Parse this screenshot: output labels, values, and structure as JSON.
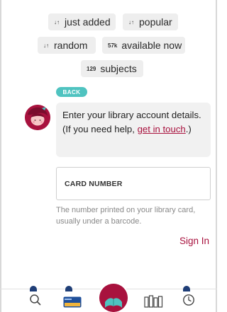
{
  "colors": {
    "brand": "#a8123e",
    "accent_teal": "#4fc3c0",
    "nav_dot": "#1f3e77",
    "chip_bg": "#eeeeee",
    "bubble_bg": "#f1f1f1"
  },
  "chips": {
    "just_added": {
      "icon": "sort-icon",
      "glyph": "↓↑",
      "label": "just added"
    },
    "popular": {
      "icon": "sort-icon",
      "glyph": "↓↑",
      "label": "popular"
    },
    "random": {
      "icon": "sort-icon",
      "glyph": "↓↑",
      "label": "random"
    },
    "available": {
      "count": "57k",
      "label": "available now"
    },
    "subjects": {
      "count": "129",
      "label": "subjects"
    }
  },
  "back_button": {
    "label": "BACK"
  },
  "message": {
    "text_before_link": "Enter your library account details. (If you need help, ",
    "link_text": "get in touch",
    "text_after_link": ".)"
  },
  "card_field": {
    "label": "CARD NUMBER"
  },
  "helper_text": "The number printed on your library card, usually under a barcode.",
  "sign_in": {
    "label": "Sign In"
  },
  "bottom_nav": {
    "items": [
      {
        "name": "search",
        "icon": "search-icon"
      },
      {
        "name": "library-card",
        "icon": "library-card-icon"
      },
      {
        "name": "home",
        "icon": "libby-home-icon"
      },
      {
        "name": "shelf",
        "icon": "shelf-icon"
      },
      {
        "name": "timeline",
        "icon": "clock-icon"
      }
    ]
  }
}
